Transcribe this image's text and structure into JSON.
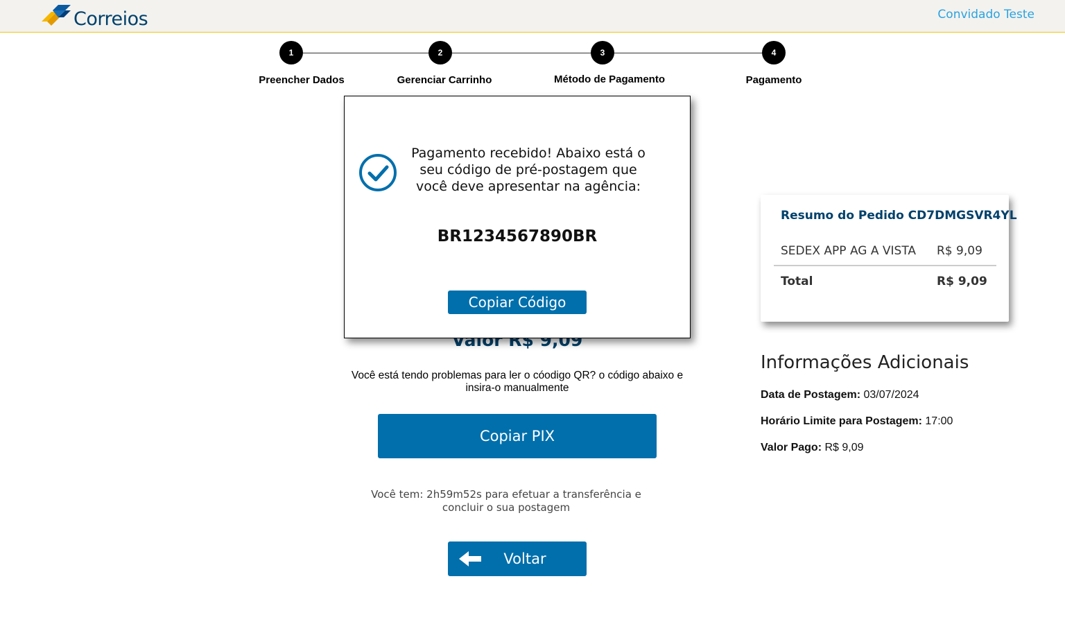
{
  "header": {
    "logo_text": "Correios",
    "user_name": "Convidado Teste"
  },
  "stepper": {
    "steps": [
      {
        "number": "1",
        "label": "Preencher Dados"
      },
      {
        "number": "2",
        "label": "Gerenciar Carrinho"
      },
      {
        "number": "3",
        "label": "Método de Pagamento"
      },
      {
        "number": "4",
        "label": "Pagamento"
      }
    ]
  },
  "payment": {
    "valor_text": "Valor R$ 9,09",
    "qr_help_text": "Você está tendo problemas para ler o cóodigo QR? o código abaixo e insira-o manualmente",
    "copy_pix_label": "Copiar PIX",
    "timer_text": "Você tem: 2h59m52s para efetuar a transferência e concluir o sua postagem",
    "back_label": "Voltar"
  },
  "summary": {
    "title": "Resumo do Pedido CD7DMGSVR4YL",
    "item_name": "SEDEX APP AG A VISTA",
    "item_price": "R$ 9,09",
    "total_label": "Total",
    "total_price": "R$ 9,09"
  },
  "info": {
    "title": "Informações Adicionais",
    "postagem_date_label": "Data de Postagem:",
    "postagem_date_value": "03/07/2024",
    "deadline_label": "Horário Limite para Postagem:",
    "deadline_value": "17:00",
    "paid_label": "Valor Pago:",
    "paid_value": "R$ 9,09"
  },
  "modal": {
    "message": "Pagamento recebido! Abaixo está o seu código de pré-postagem que você deve apresentar na agência:",
    "code": "BR1234567890BR",
    "copy_code_label": "Copiar Código"
  },
  "colors": {
    "brand_blue": "#006fac",
    "dark_blue": "#00416b",
    "link_blue": "#2aa3e0",
    "logo_yellow": "#f5b700"
  },
  "icons": [
    "correios-logo",
    "check-circle-icon",
    "arrow-left-icon"
  ]
}
